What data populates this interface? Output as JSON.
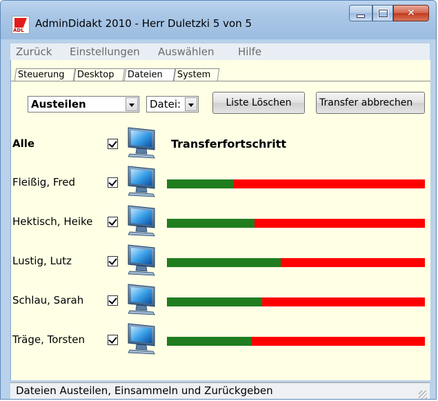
{
  "window": {
    "title": "AdminDidakt 2010 - Herr Duletzki  5 von 5",
    "app_icon_text": "ADL"
  },
  "menu": [
    "Zurück",
    "Einstellungen",
    "Auswählen",
    "Hilfe"
  ],
  "tabs": [
    {
      "label": "Steuerung",
      "active": false
    },
    {
      "label": "Desktop",
      "active": false
    },
    {
      "label": "Dateien",
      "active": true
    },
    {
      "label": "System",
      "active": false
    }
  ],
  "toolbar": {
    "mode_select": "Austeilen",
    "type_select": "Datei:",
    "clear_button": "Liste Löschen",
    "abort_button": "Transfer abbrechen"
  },
  "header_row": {
    "label": "Alle",
    "checked": true,
    "progress_heading": "Transferfortschritt"
  },
  "students": [
    {
      "name": "Fleißig, Fred",
      "checked": true,
      "progress": 0.26
    },
    {
      "name": "Hektisch, Heike",
      "checked": true,
      "progress": 0.34
    },
    {
      "name": "Lustig, Lutz",
      "checked": true,
      "progress": 0.44
    },
    {
      "name": "Schlau, Sarah",
      "checked": true,
      "progress": 0.37
    },
    {
      "name": "Träge, Torsten",
      "checked": true,
      "progress": 0.33
    }
  ],
  "status_bar": "Dateien Austeilen, Einsammeln und Zurückgeben",
  "colors": {
    "progress_done": "#1f7d1f",
    "progress_remaining": "#ff0000",
    "client_background": "#ffffe5"
  }
}
